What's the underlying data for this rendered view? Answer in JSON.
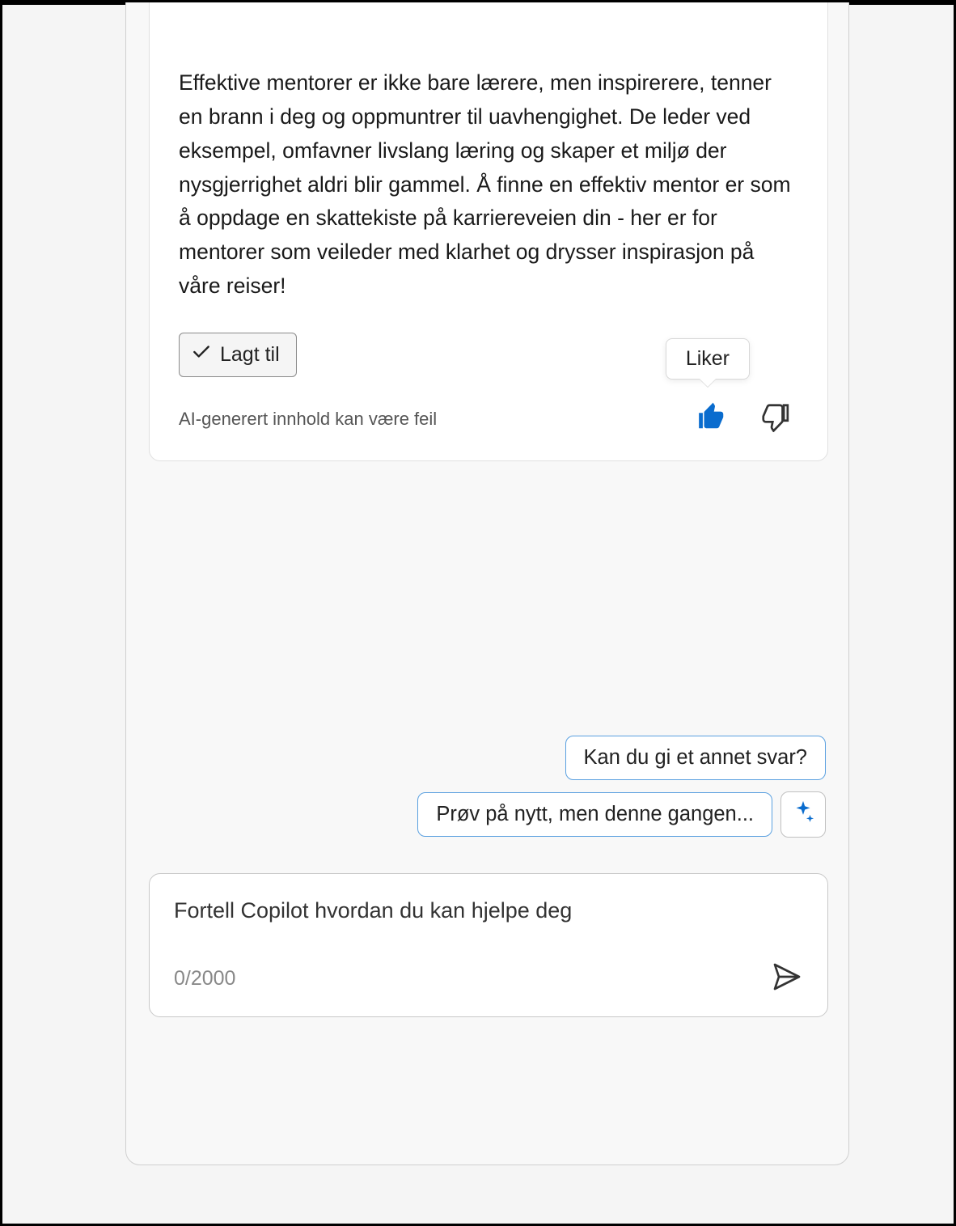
{
  "message": {
    "text": "Effektive mentorer er ikke bare lærere, men inspirerere, tenner en brann i deg og oppmuntrer til uavhengighet. De leder ved eksempel, omfavner livslang læring og skaper et miljø der nysgjerrighet aldri blir gammel. Å finne en effektiv mentor er som å oppdage en skattekiste på karriereveien din - her er for mentorer som veileder med klarhet og drysser inspirasjon på våre reiser!",
    "added_label": "Lagt til",
    "disclaimer": "AI-generert innhold kan være feil",
    "tooltip_like": "Liker"
  },
  "suggestions": [
    {
      "label": "Kan du gi et annet svar?"
    },
    {
      "label": "Prøv på nytt, men denne gangen..."
    }
  ],
  "input": {
    "placeholder": "Fortell Copilot hvordan du kan hjelpe deg",
    "char_count": "0/2000"
  }
}
